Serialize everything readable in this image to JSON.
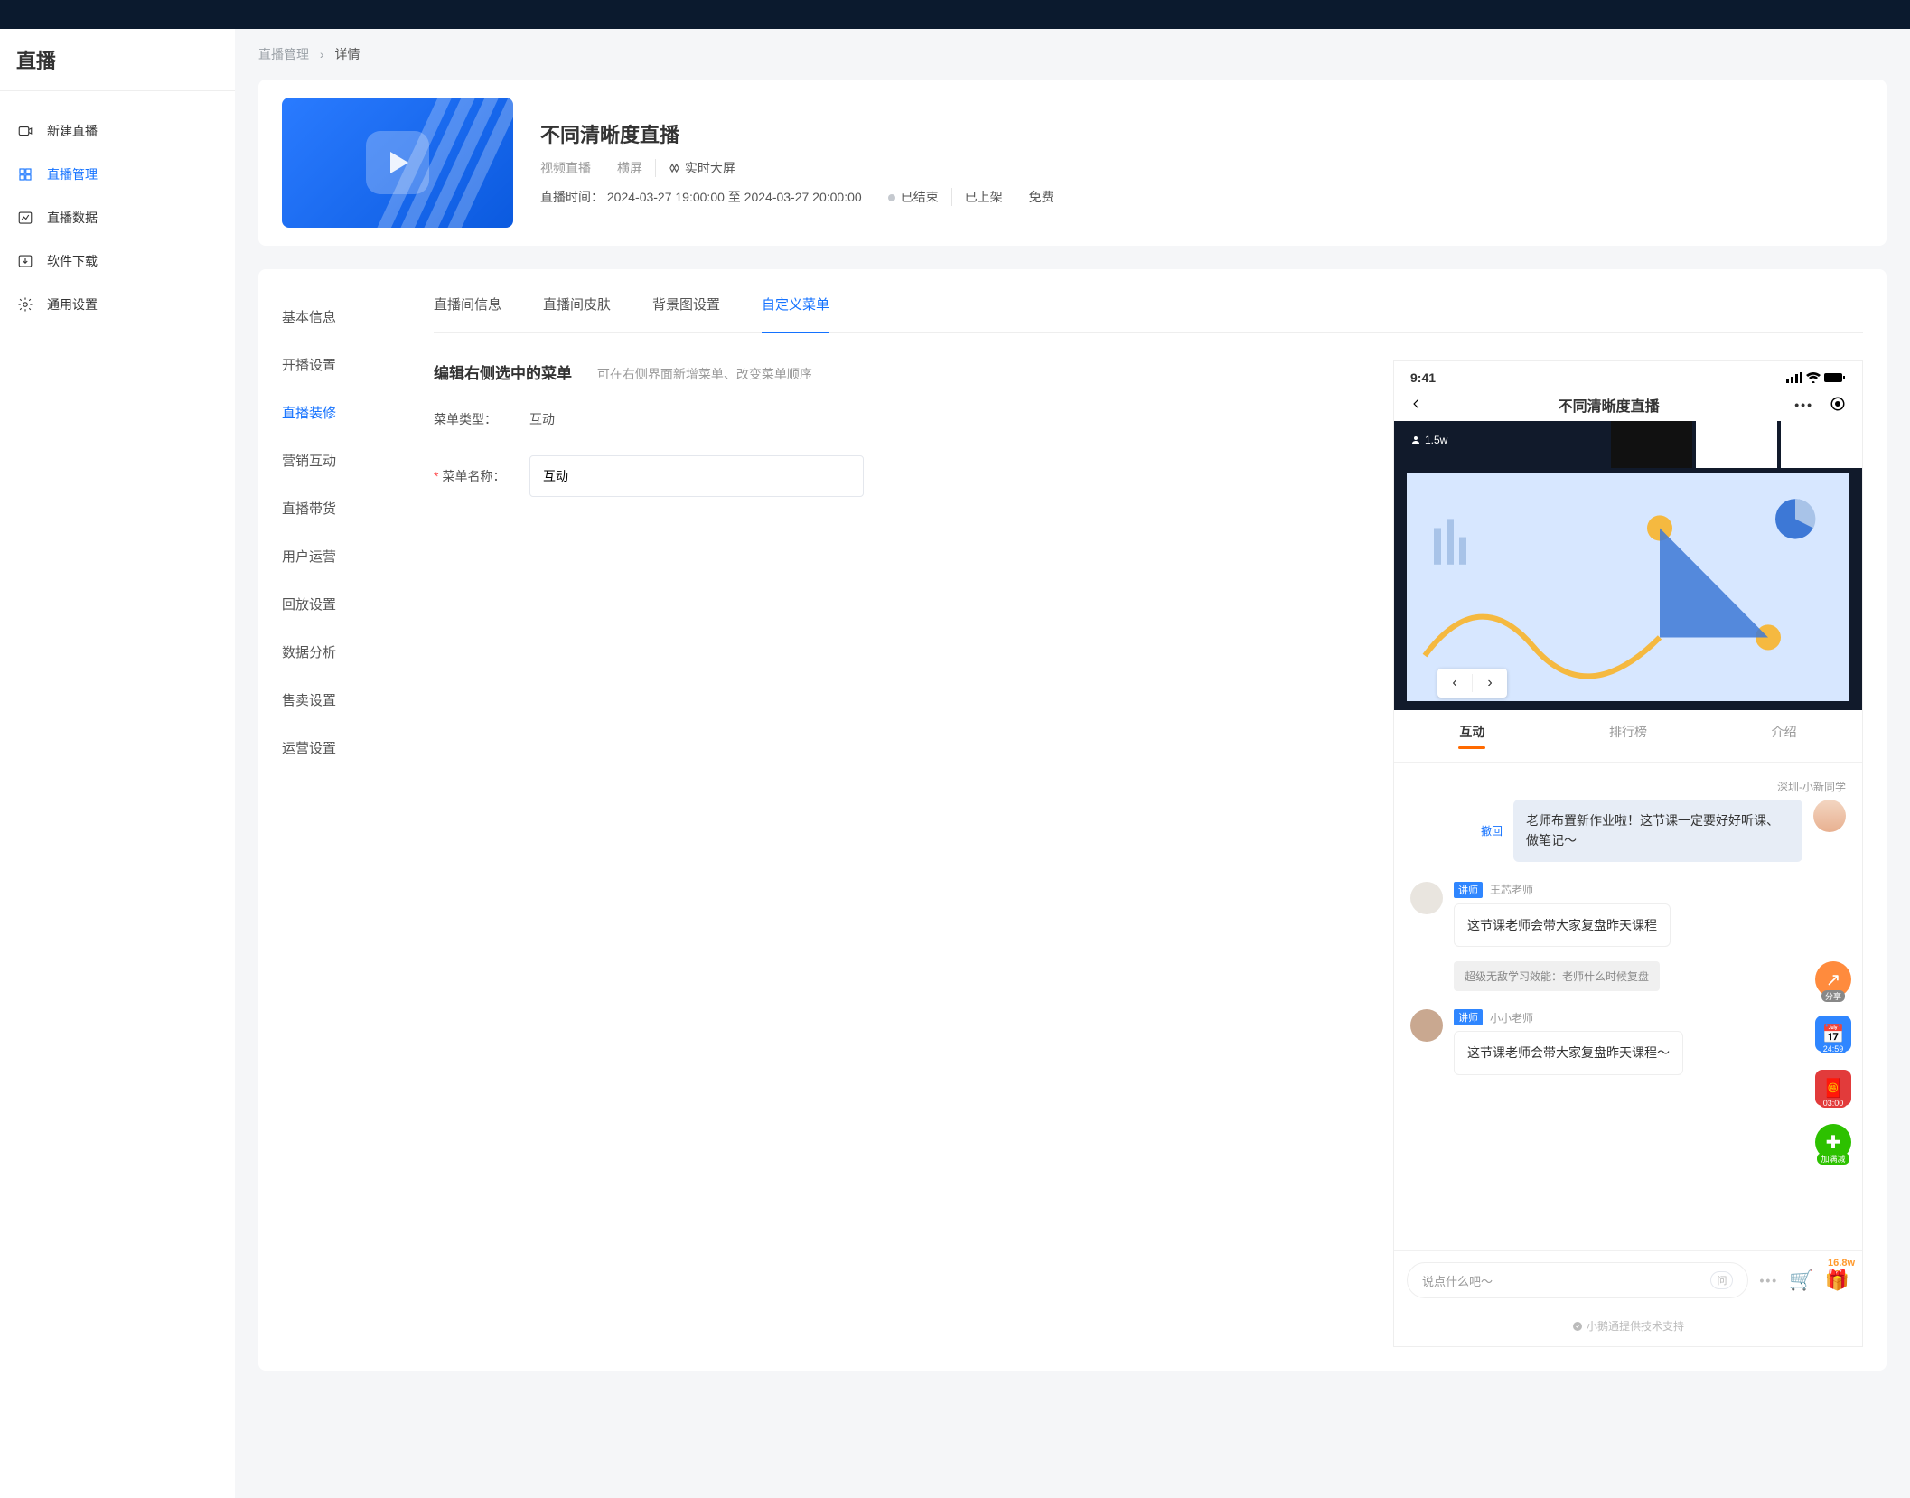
{
  "app": {
    "title": "直播"
  },
  "nav": {
    "items": [
      {
        "label": "新建直播"
      },
      {
        "label": "直播管理"
      },
      {
        "label": "直播数据"
      },
      {
        "label": "软件下载"
      },
      {
        "label": "通用设置"
      }
    ]
  },
  "breadcrumb": {
    "a": "直播管理",
    "b": "详情"
  },
  "info": {
    "title": "不同清晰度直播",
    "type": "视频直播",
    "orientation": "横屏",
    "dash_label": "实时大屏",
    "time_label": "直播时间：",
    "time_value": "2024-03-27 19:00:00 至 2024-03-27 20:00:00",
    "status_end": "已结束",
    "status_publish": "已上架",
    "price": "免费"
  },
  "sub_menu": {
    "items": [
      {
        "label": "基本信息"
      },
      {
        "label": "开播设置"
      },
      {
        "label": "直播装修"
      },
      {
        "label": "营销互动"
      },
      {
        "label": "直播带货"
      },
      {
        "label": "用户运营"
      },
      {
        "label": "回放设置"
      },
      {
        "label": "数据分析"
      },
      {
        "label": "售卖设置"
      },
      {
        "label": "运营设置"
      }
    ]
  },
  "tabs": {
    "items": [
      {
        "label": "直播间信息"
      },
      {
        "label": "直播间皮肤"
      },
      {
        "label": "背景图设置"
      },
      {
        "label": "自定义菜单"
      }
    ]
  },
  "form": {
    "heading": "编辑右侧选中的菜单",
    "hint": "可在右侧界面新增菜单、改变菜单顺序",
    "type_label": "菜单类型：",
    "type_value": "互动",
    "name_label": "菜单名称：",
    "name_value": "互动"
  },
  "phone": {
    "time": "9:41",
    "title": "不同清晰度直播",
    "audience": "1.5w",
    "chat_tabs": [
      {
        "label": "互动"
      },
      {
        "label": "排行榜"
      },
      {
        "label": "介绍"
      }
    ],
    "msg1": {
      "name": "深圳-小新同学",
      "bubble": "老师布置新作业啦！这节课一定要好好听课、做笔记～",
      "revoke": "撤回"
    },
    "msg2": {
      "badge": "讲师",
      "name": "王芯老师",
      "bubble": "这节课老师会带大家复盘昨天课程"
    },
    "sys": "超级无敌学习效能：老师什么时候复盘",
    "msg3": {
      "badge": "讲师",
      "name": "小小老师",
      "bubble": "这节课老师会带大家复盘昨天课程～"
    },
    "float": {
      "share": "分享",
      "calendar": "24:59",
      "redpack": "03:00",
      "wechat": "加满减"
    },
    "input_placeholder": "说点什么吧～",
    "ask_label": "问",
    "gift_count": "16.8w",
    "footer": "小鹅通提供技术支持"
  }
}
